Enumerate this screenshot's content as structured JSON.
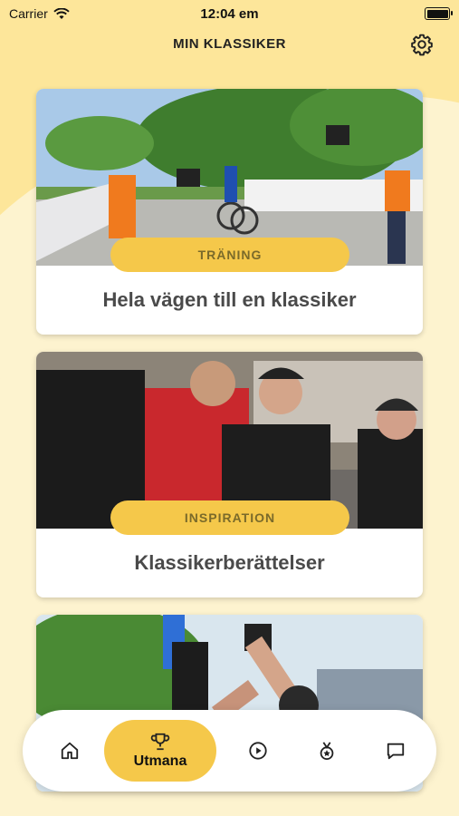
{
  "status": {
    "carrier": "Carrier",
    "time": "12:04 em"
  },
  "header": {
    "title": "MIN KLASSIKER"
  },
  "cards": [
    {
      "tag": "TRÄNING",
      "title": "Hela vägen till en klassiker"
    },
    {
      "tag": "INSPIRATION",
      "title": "Klassikerberättelser"
    },
    {
      "tag": "",
      "title": ""
    }
  ],
  "tabbar": {
    "items": [
      {
        "icon": "home-icon"
      },
      {
        "icon": "trophy-icon",
        "label": "Utmana",
        "active": true
      },
      {
        "icon": "play-circle-icon"
      },
      {
        "icon": "medal-icon"
      },
      {
        "icon": "chat-icon"
      }
    ]
  },
  "colors": {
    "accent": "#f5c84a",
    "background": "#fdf3cf",
    "header_bg": "#fde69a"
  }
}
